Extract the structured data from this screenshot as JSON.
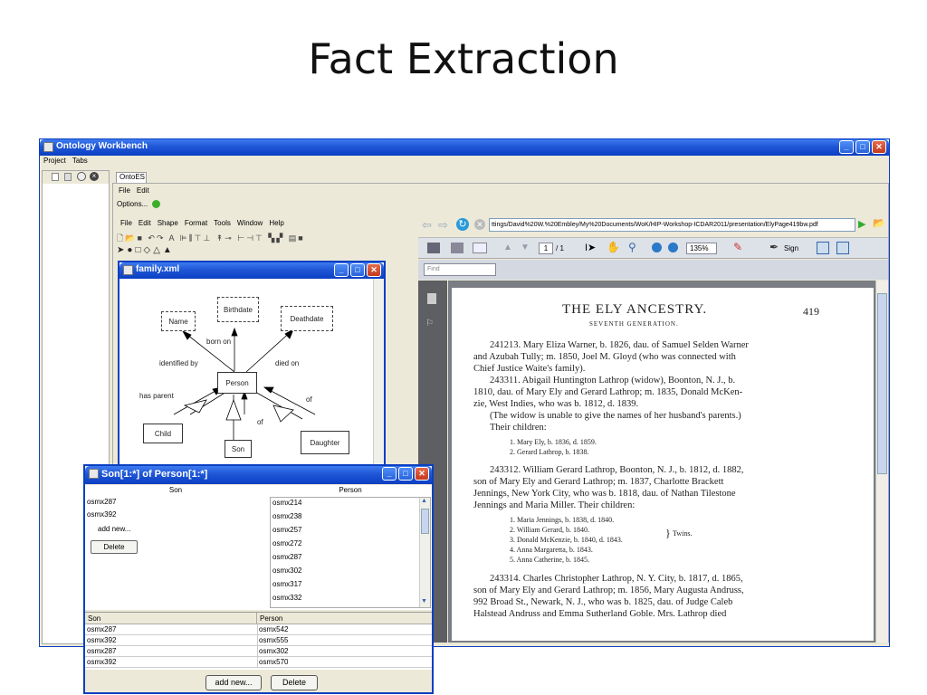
{
  "slide": {
    "title": "Fact Extraction"
  },
  "main_window": {
    "title": "Ontology Workbench",
    "menu": [
      "Project",
      "Tabs"
    ],
    "tab_label": "OntoES",
    "inner_menu": [
      "File",
      "Edit"
    ],
    "options_label": "Options...",
    "editor_menu": [
      "File",
      "Edit",
      "Shape",
      "Format",
      "Tools",
      "Window",
      "Help"
    ]
  },
  "family_window": {
    "title": "family.xml",
    "nodes": {
      "name": "Name",
      "birthdate": "Birthdate",
      "deathdate": "Deathdate",
      "person": "Person",
      "child": "Child",
      "daughter": "Daughter",
      "son": "Son"
    },
    "edges": {
      "born_on": "born on",
      "identified_by": "identified by",
      "died_on": "died on",
      "has_parent": "has parent",
      "of1": "of",
      "of2": "of"
    }
  },
  "pdf_viewer": {
    "url": "ttings/David%20W.%20Embley/My%20Documents/WoK/HIP-Workshop-ICDAR2011/presentation/ElyPage419bw.pdf",
    "page_current": "1",
    "page_total": "/ 1",
    "zoom": "135%",
    "sign_label": "Sign",
    "find_placeholder": "Find",
    "doc": {
      "heading": "THE ELY ANCESTRY.",
      "page_no": "419",
      "subheading": "SEVENTH GENERATION.",
      "lines": [
        "241213. Mary Eliza Warner, b. 1826, dau. of Samuel Selden Warner",
        "and Azubah Tully; m. 1850, Joel M. Gloyd (who was connected with",
        "Chief Justice Waite's family).",
        "243311. Abigail Huntington Lathrop (widow), Boonton, N. J., b.",
        "1810, dau. of Mary Ely and Gerard Lathrop; m. 1835, Donald McKen-",
        "zie, West Indies, who was b. 1812, d. 1839.",
        "(The widow is unable to give the names of her husband's parents.)",
        "Their children:",
        "1. Mary Ely, b. 1836, d. 1859.",
        "2. Gerard Lathrop, b. 1838.",
        "243312. William Gerard Lathrop, Boonton, N. J., b. 1812, d. 1882,",
        "son of Mary Ely and Gerard Lathrop; m. 1837, Charlotte Brackett",
        "Jennings, New York City, who was b. 1818, dau. of Nathan Tilestone",
        "Jennings and Maria Miller.  Their children:",
        "1. Maria Jennings, b. 1838, d. 1840.",
        "2. William Gerard, b. 1840.",
        "3. Donald McKenzie, b. 1840, d. 1843.",
        "4. Anna Margaretta, b. 1843.",
        "5. Anna Catherine, b. 1845.",
        "243314. Charles Christopher Lathrop, N. Y. City, b. 1817, d. 1865,",
        "son of Mary Ely and Gerard Lathrop; m. 1856, Mary Augusta Andruss,",
        "992 Broad St., Newark, N. J., who was b. 1825, dau. of Judge Caleb",
        "Halstead Andruss and Emma Sutherland Goble.  Mrs. Lathrop died"
      ],
      "twins": "Twins."
    }
  },
  "son_window": {
    "title": "Son[1:*] of Person[1:*]",
    "col_son": "Son",
    "col_person": "Person",
    "son_list": [
      "osmx287",
      "osmx392"
    ],
    "add_new_label": "add new...",
    "delete_label": "Delete",
    "person_list": [
      "osmx214",
      "osmx238",
      "osmx257",
      "osmx272",
      "osmx287",
      "osmx302",
      "osmx317",
      "osmx332"
    ],
    "table_headers": [
      "Son",
      "Person"
    ],
    "table_rows": [
      [
        "osmx287",
        "osmx542"
      ],
      [
        "osmx392",
        "osmx555"
      ],
      [
        "osmx287",
        "osmx302"
      ],
      [
        "osmx392",
        "osmx570"
      ]
    ],
    "bottom_add": "add new...",
    "bottom_delete": "Delete"
  }
}
